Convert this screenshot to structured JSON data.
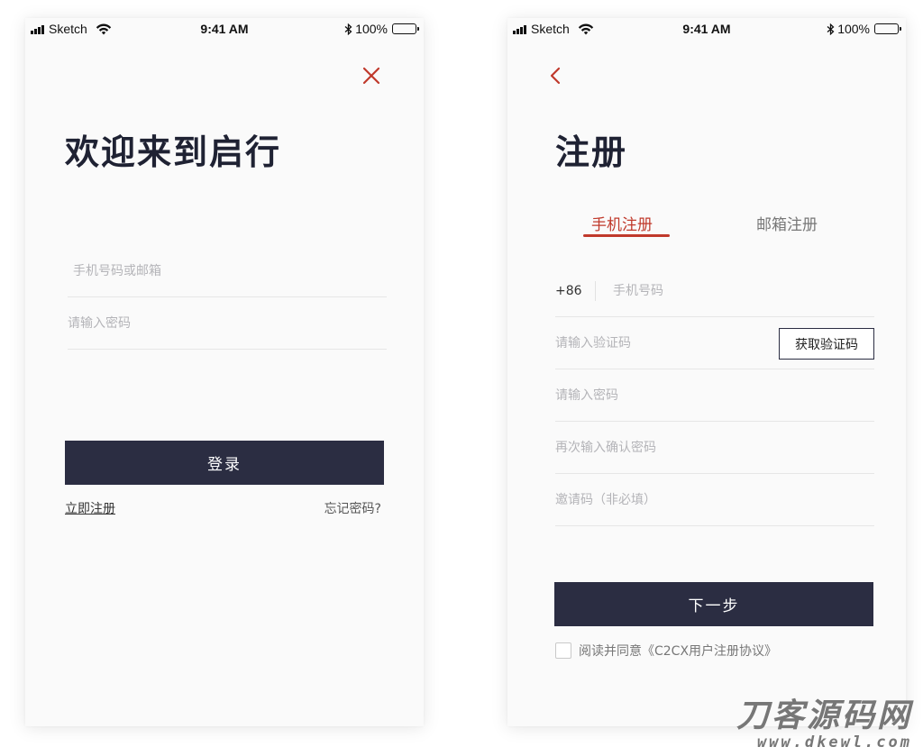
{
  "status_bar": {
    "carrier": "Sketch",
    "time": "9:41 AM",
    "battery": "100%"
  },
  "login": {
    "title": "欢迎来到启行",
    "account_placeholder": "手机号码或邮箱",
    "password_placeholder": "请输入密码",
    "login_button": "登录",
    "register_link": "立即注册",
    "forgot_link": "忘记密码?"
  },
  "register": {
    "title": "注册",
    "tabs": [
      {
        "label": "手机注册",
        "active": true
      },
      {
        "label": "邮箱注册",
        "active": false
      }
    ],
    "country_code": "+86",
    "phone_placeholder": "手机号码",
    "code_placeholder": "请输入验证码",
    "get_code_button": "获取验证码",
    "password_placeholder": "请输入密码",
    "confirm_password_placeholder": "再次输入确认密码",
    "invite_placeholder": "邀请码（非必填）",
    "next_button": "下一步",
    "agreement_text": "阅读并同意《C2CX用户注册协议》"
  },
  "watermark": {
    "brand": "刀客源码网",
    "url": "www.dkewl.com"
  },
  "colors": {
    "primary": "#2b2d42",
    "accent": "#c0392b",
    "background": "#fafafa"
  },
  "icons": [
    "signal-icon",
    "wifi-icon",
    "bluetooth-icon",
    "battery-icon",
    "close-icon",
    "back-icon"
  ]
}
